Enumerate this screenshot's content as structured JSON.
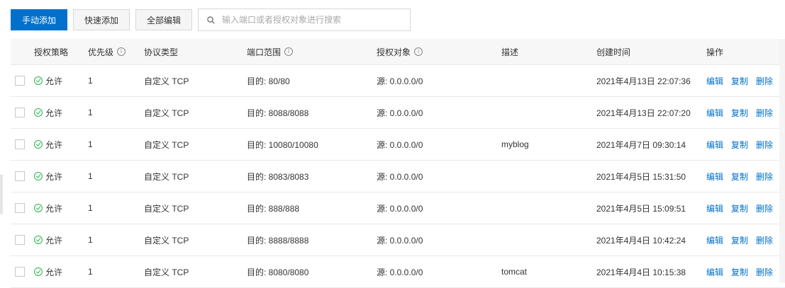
{
  "toolbar": {
    "manual_add": "手动添加",
    "quick_add": "快速添加",
    "edit_all": "全部编辑",
    "search_placeholder": "输入端口或者授权对象进行搜索"
  },
  "columns": {
    "policy": "授权策略",
    "priority": "优先级",
    "protocol": "协议类型",
    "port": "端口范围",
    "auth": "授权对象",
    "desc": "描述",
    "time": "创建时间",
    "ops": "操作"
  },
  "rows": [
    {
      "policy": "允许",
      "priority": "1",
      "protocol": "自定义 TCP",
      "port": "目的: 80/80",
      "auth": "源: 0.0.0.0/0",
      "desc": "",
      "time": "2021年4月13日 22:07:36"
    },
    {
      "policy": "允许",
      "priority": "1",
      "protocol": "自定义 TCP",
      "port": "目的: 8088/8088",
      "auth": "源: 0.0.0.0/0",
      "desc": "",
      "time": "2021年4月13日 22:07:20"
    },
    {
      "policy": "允许",
      "priority": "1",
      "protocol": "自定义 TCP",
      "port": "目的: 10080/10080",
      "auth": "源: 0.0.0.0/0",
      "desc": "myblog",
      "time": "2021年4月7日 09:30:14"
    },
    {
      "policy": "允许",
      "priority": "1",
      "protocol": "自定义 TCP",
      "port": "目的: 8083/8083",
      "auth": "源: 0.0.0.0/0",
      "desc": "",
      "time": "2021年4月5日 15:31:50"
    },
    {
      "policy": "允许",
      "priority": "1",
      "protocol": "自定义 TCP",
      "port": "目的: 888/888",
      "auth": "源: 0.0.0.0/0",
      "desc": "",
      "time": "2021年4月5日 15:09:51"
    },
    {
      "policy": "允许",
      "priority": "1",
      "protocol": "自定义 TCP",
      "port": "目的: 8888/8888",
      "auth": "源: 0.0.0.0/0",
      "desc": "",
      "time": "2021年4月4日 10:42:24"
    },
    {
      "policy": "允许",
      "priority": "1",
      "protocol": "自定义 TCP",
      "port": "目的: 8080/8080",
      "auth": "源: 0.0.0.0/0",
      "desc": "tomcat",
      "time": "2021年4月4日 10:15:38"
    }
  ],
  "actions": {
    "edit": "编辑",
    "copy": "复制",
    "delete": "删除"
  },
  "colors": {
    "primary": "#0070cc",
    "allow": "#2cb34c"
  }
}
